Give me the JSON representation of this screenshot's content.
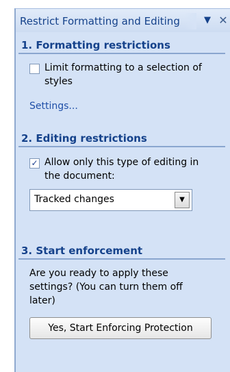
{
  "pane": {
    "title": "Restrict Formatting and Editing"
  },
  "icons": {
    "menu": "dropdown-triangle",
    "close": "x"
  },
  "sections": {
    "formatting": {
      "heading": "1. Formatting restrictions",
      "checkbox_label_line1": "Limit formatting to a selection of",
      "checkbox_label_line2": "styles",
      "checkbox_checked": false,
      "settings_link": "Settings..."
    },
    "editing": {
      "heading": "2. Editing restrictions",
      "checkbox_label_line1": "Allow only this type of editing in",
      "checkbox_label_line2": "the document:",
      "checkbox_checked": true,
      "select_value": "Tracked changes"
    },
    "enforcement": {
      "heading": "3. Start enforcement",
      "question_line1": "Are you ready to apply these",
      "question_line2": "settings? (You can turn them off",
      "question_line3": "later)",
      "button_label": "Yes, Start Enforcing Protection"
    }
  },
  "colors": {
    "pane_background": "#d4e2f6",
    "heading_text": "#15428b",
    "link_text": "#1f4fa8"
  }
}
